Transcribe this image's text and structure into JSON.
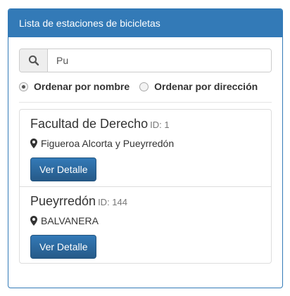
{
  "panel": {
    "title": "Lista de estaciones de bicicletas"
  },
  "search": {
    "value": "Pu",
    "icon": "search-icon"
  },
  "sort": {
    "options": [
      {
        "label": "Ordenar por nombre",
        "checked": true
      },
      {
        "label": "Ordenar por dirección",
        "checked": false
      }
    ]
  },
  "stations": [
    {
      "name": "Facultad de Derecho",
      "id_label": "ID: 1",
      "address": "Figueroa Alcorta y Pueyrredón",
      "button": "Ver Detalle"
    },
    {
      "name": "Pueyrredón",
      "id_label": "ID: 144",
      "address": "BALVANERA",
      "button": "Ver Detalle"
    }
  ],
  "colors": {
    "primary": "#337ab7",
    "primary_dark": "#265a88"
  }
}
